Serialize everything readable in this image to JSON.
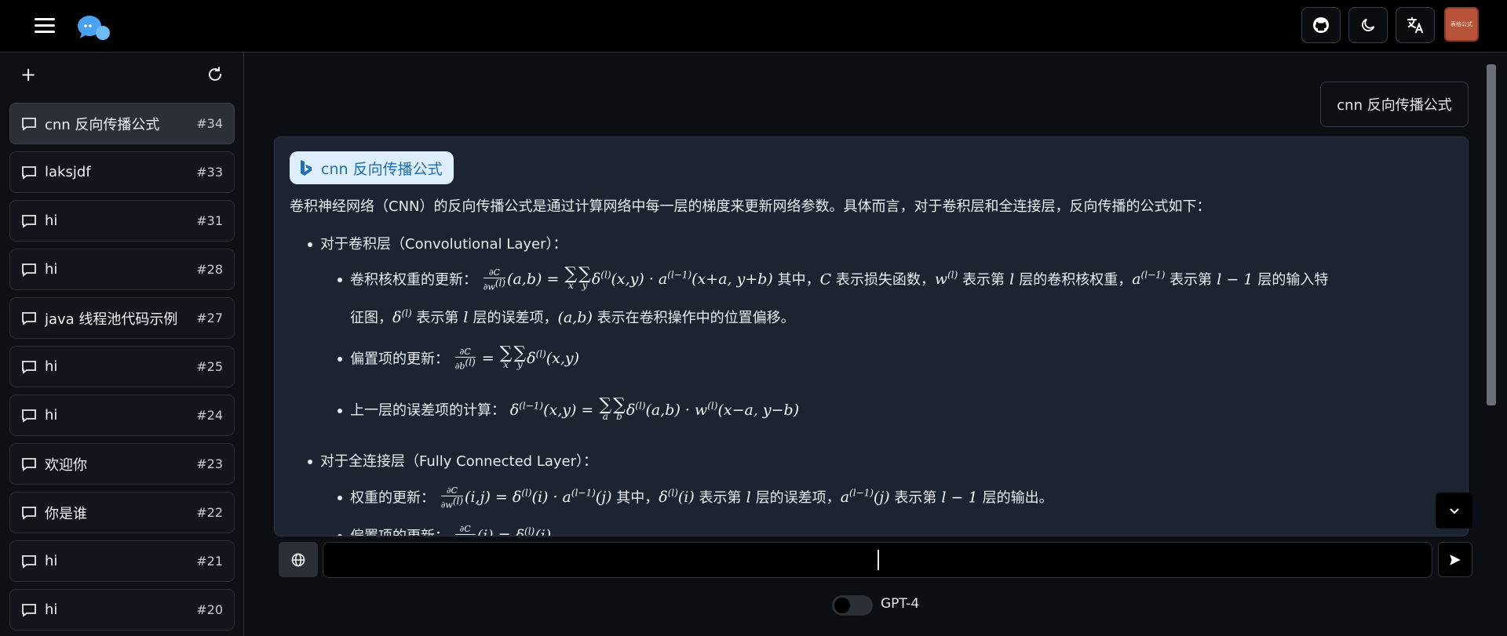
{
  "header": {
    "menu_icon": "hamburger-icon",
    "logo_icon": "chat-bubbles-logo",
    "buttons": [
      "github-icon",
      "moon-icon",
      "translate-icon"
    ],
    "avatar_text": "表格公式"
  },
  "sidebar": {
    "new_icon": "+",
    "refresh_icon": "refresh-icon",
    "items": [
      {
        "label": "cnn 反向传播公式",
        "num": "#34",
        "active": true
      },
      {
        "label": "laksjdf",
        "num": "#33"
      },
      {
        "label": "hi",
        "num": "#31"
      },
      {
        "label": "hi",
        "num": "#28"
      },
      {
        "label": "java 线程池代码示例",
        "num": "#27"
      },
      {
        "label": "hi",
        "num": "#25"
      },
      {
        "label": "hi",
        "num": "#24"
      },
      {
        "label": "欢迎你",
        "num": "#23"
      },
      {
        "label": "你是谁",
        "num": "#22"
      },
      {
        "label": "hi",
        "num": "#21"
      },
      {
        "label": "hi",
        "num": "#20"
      }
    ]
  },
  "chat": {
    "user_message": "cnn 反向传播公式",
    "source_badge": "cnn 反向传播公式",
    "intro": "卷积神经网络（CNN）的反向传播公式是通过计算网络中每一层的梯度来更新网络参数。具体而言，对于卷积层和全连接层，反向传播的公式如下：",
    "conv_layer": "对于卷积层（Convolutional Layer）：",
    "kernel_update_label": "卷积核权重的更新：",
    "kernel_update_text1": "其中，",
    "kernel_update_text2": "表示损失函数，",
    "kernel_update_text3": "表示第",
    "kernel_update_text4": "层的卷积核权重，",
    "kernel_update_text5": "表示第",
    "kernel_update_text6": "层的输入特",
    "kernel_update_cont1": "征图，",
    "kernel_update_cont2": "表示第",
    "kernel_update_cont3": "层的误差项，",
    "kernel_update_cont4": "表示在卷积操作中的位置偏移。",
    "bias_update_label": "偏置项的更新：",
    "prev_error_label": "上一层的误差项的计算：",
    "fc_layer": "对于全连接层（Fully Connected Layer）：",
    "weight_update_label": "权重的更新：",
    "weight_update_text1": "其中，",
    "weight_update_text2": "表示第",
    "weight_update_text3": "层的误差项，",
    "weight_update_text4": "表示第",
    "weight_update_text5": "层的输出。",
    "bias_update2_label": "偏置项的更新："
  },
  "composer": {
    "globe_icon": "globe-icon",
    "placeholder": "",
    "send_icon": "send-icon",
    "model_label": "GPT-4",
    "model_toggle_on": false
  }
}
